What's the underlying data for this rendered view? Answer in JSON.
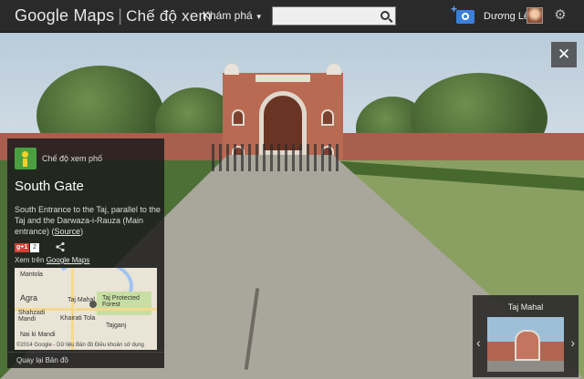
{
  "header": {
    "brand": "Google",
    "product": "Maps",
    "mode": "Chế độ xem",
    "explore_label": "Khám phá",
    "search_placeholder": "",
    "user_name": "Dương Lê"
  },
  "panel": {
    "street_view_label": "Chế độ xem phố",
    "place_title": "South Gate",
    "description": "South Entrance to the Taj, parallel to the Taj and the Darwaza-i-Rauza (Main entrance)",
    "source_link": "Source",
    "gplus_label": "g+1",
    "gplus_count": "2",
    "view_on_prefix": "Xem trên",
    "view_on_link": "Google Maps",
    "map_labels": {
      "mantola": "Mantola",
      "agra": "Agra",
      "taj_mahal": "Taj Mahal",
      "taj_forest": "Taj Protected Forest",
      "shahzadi_mandi": "Shahzadi Mandi",
      "khairati_tola": "Khairati Tola",
      "tajganj": "Tajganj",
      "nai_ki_mandi": "Nai ki Mandi",
      "credit": "©2014 Google - Dữ liệu Bản đồ   Điều khoản sử dụng"
    },
    "back_to_map": "Quay lại Bản đồ"
  },
  "photo_strip": {
    "title": "Taj Mahal"
  },
  "colors": {
    "topbar": "#2a2a2a",
    "accent_blue": "#3b7fd9",
    "gplus_red": "#d23f31"
  }
}
